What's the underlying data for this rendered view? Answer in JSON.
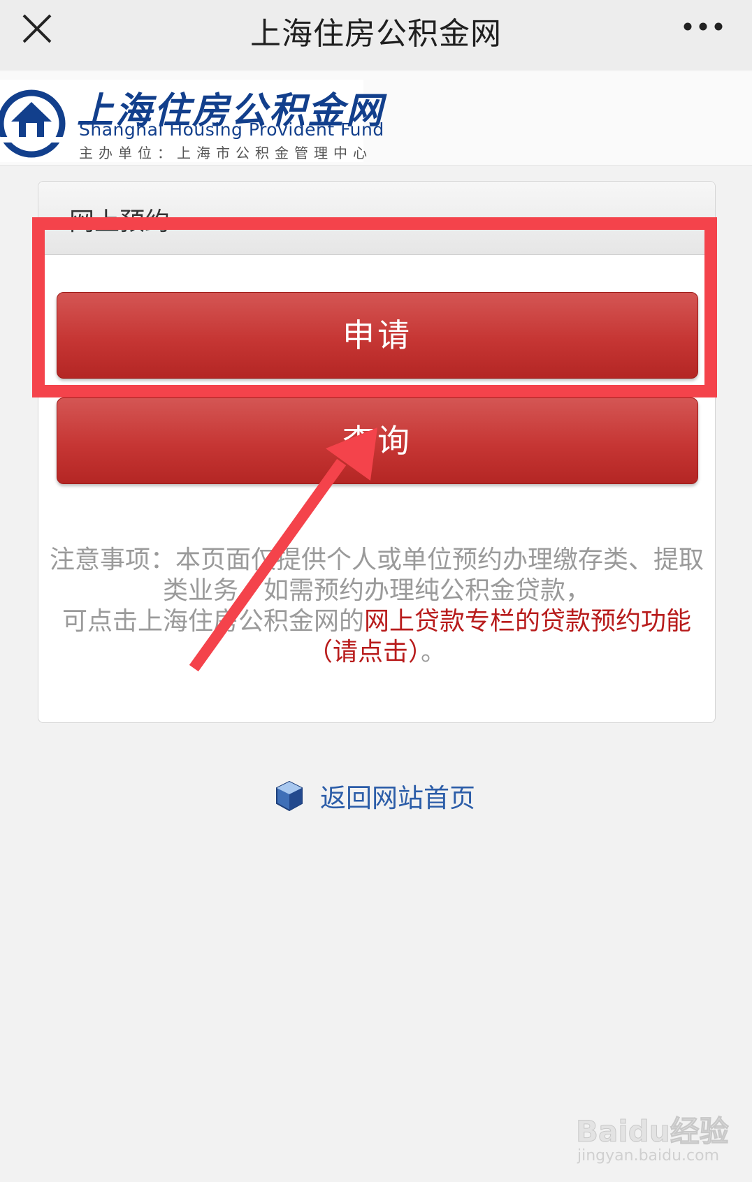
{
  "titlebar": {
    "title": "上海住房公积金网",
    "close_icon": "close-icon",
    "more_icon": "more-horizontal-icon"
  },
  "header": {
    "logo_cn": "上海住房公积金网",
    "logo_en": "Shanghai Housing Provident Fund",
    "logo_sub": "主办单位：上海市公积金管理中心",
    "logo_icon": "house-emblem-icon",
    "brand_color": "#123f8c"
  },
  "card": {
    "title": "网上预约",
    "apply_label": "申请",
    "query_label": "查询",
    "button_color": "#c63634"
  },
  "notice": {
    "line1": "注意事项：本页面仅提供个人或单位预约办理缴存类、提取类业务，如需预约办理纯公积金贷款，",
    "line2_prefix": "可点击上海住房公积金网的",
    "link_text": "网上贷款专栏的贷款预约功能（请点击）",
    "line2_suffix": "。"
  },
  "footer": {
    "back_label": "返回网站首页",
    "back_icon": "cube-icon"
  },
  "annotation": {
    "highlight_color": "#f4434b",
    "arrow_icon": "arrow-up-right-icon"
  },
  "watermark": {
    "logo": "Baidu经验",
    "url": "jingyan.baidu.com"
  }
}
